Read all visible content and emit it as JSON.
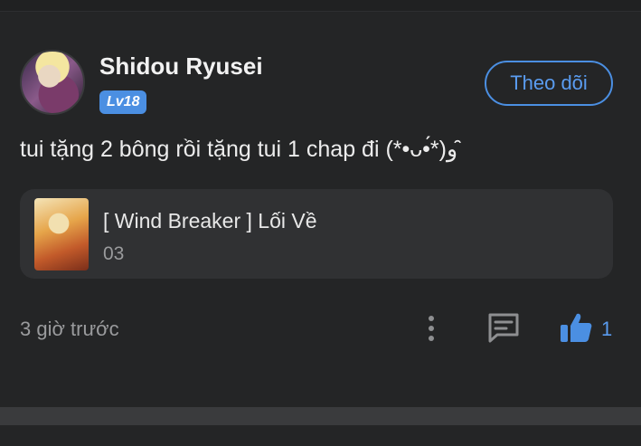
{
  "post": {
    "username": "Shidou Ryusei",
    "level": "Lv18",
    "follow_label": "Theo dõi",
    "comment": "tui tặng 2 bông rồi tặng tui 1 chap đi (*•ᴗ•́*)و ̑̑",
    "card": {
      "title": "[ Wind Breaker ] Lối Về",
      "chapter": "03"
    },
    "time": "3 giờ trước",
    "likes": "1"
  },
  "colors": {
    "background": "#242526",
    "card": "#303133",
    "accent": "#4b8fe2",
    "muted": "#9a9b9d"
  },
  "icons": {
    "more": "more-vertical-icon",
    "comment": "comment-icon",
    "like": "thumbs-up-icon"
  }
}
